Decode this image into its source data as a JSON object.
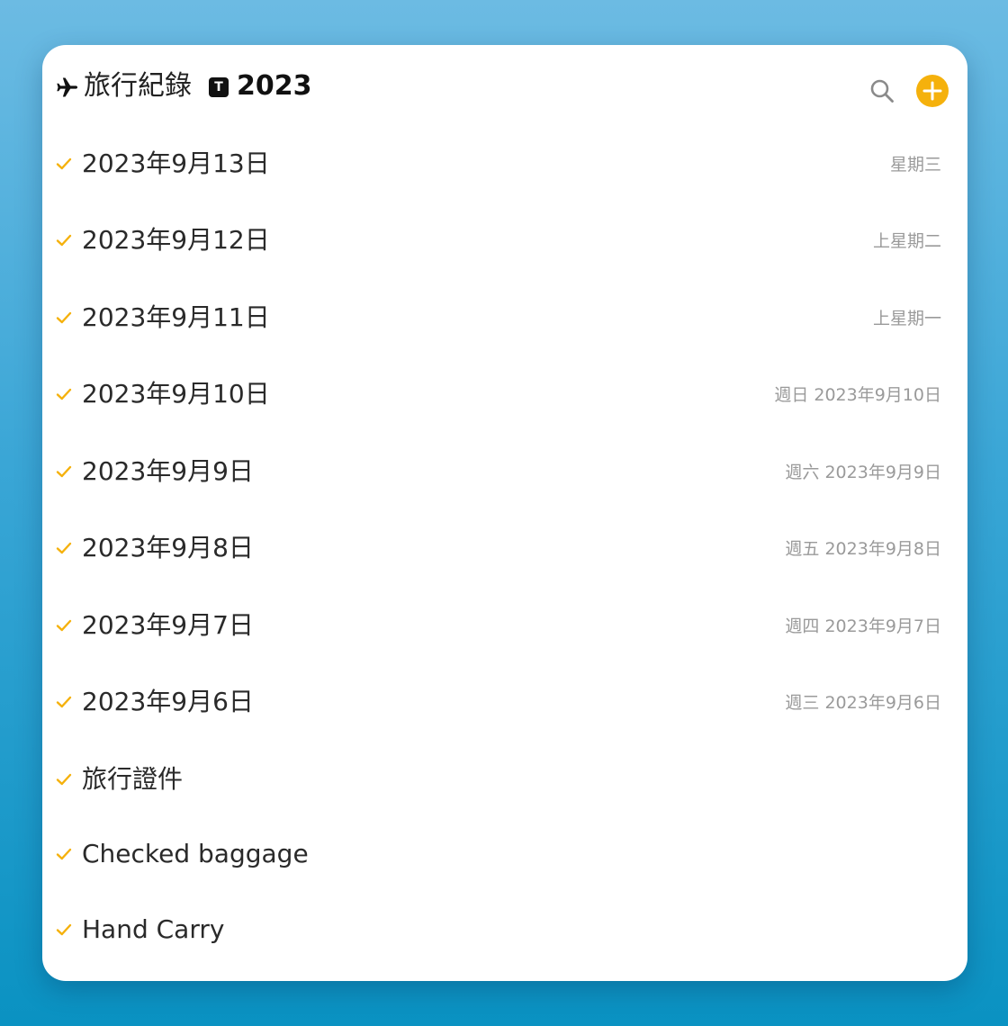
{
  "header": {
    "plane_icon": "airplane-icon",
    "title": "旅行紀錄",
    "tag_letter": "T",
    "year": "2023",
    "search_icon": "search-icon",
    "add_icon": "plus-icon"
  },
  "colors": {
    "accent": "#f5b10c",
    "check": "#f5b10c",
    "text": "#2a2a2a",
    "meta": "#9a9a9a",
    "background_top": "#6cbbe3",
    "background_bottom": "#0a92c2"
  },
  "items": [
    {
      "label": "2023年9月13日",
      "meta": "星期三",
      "done": true
    },
    {
      "label": "2023年9月12日",
      "meta": "上星期二",
      "done": true
    },
    {
      "label": "2023年9月11日",
      "meta": "上星期一",
      "done": true
    },
    {
      "label": "2023年9月10日",
      "meta": "週日 2023年9月10日",
      "done": true
    },
    {
      "label": "2023年9月9日",
      "meta": "週六 2023年9月9日",
      "done": true
    },
    {
      "label": "2023年9月8日",
      "meta": "週五 2023年9月8日",
      "done": true
    },
    {
      "label": "2023年9月7日",
      "meta": "週四 2023年9月7日",
      "done": true
    },
    {
      "label": "2023年9月6日",
      "meta": "週三 2023年9月6日",
      "done": true
    },
    {
      "label": "旅行證件",
      "meta": "",
      "done": true
    },
    {
      "label": "Checked baggage",
      "meta": "",
      "done": true
    },
    {
      "label": "Hand Carry",
      "meta": "",
      "done": true
    }
  ]
}
